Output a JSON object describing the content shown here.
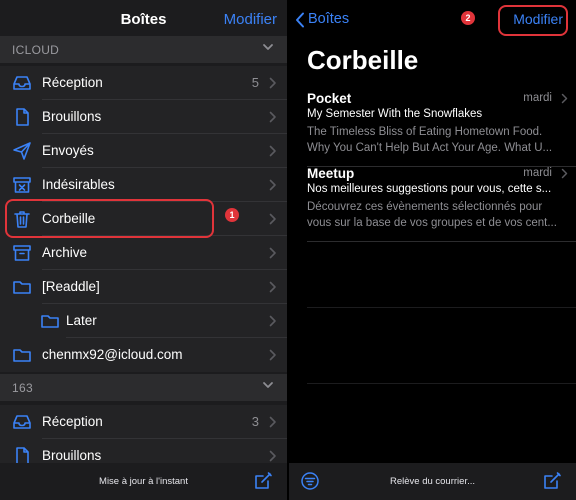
{
  "left": {
    "title": "Boîtes",
    "edit_label": "Modifier",
    "sections": [
      {
        "label": "ICLOUD",
        "items": [
          {
            "icon": "inbox-icon",
            "label": "Réception",
            "count": "5"
          },
          {
            "icon": "document-icon",
            "label": "Brouillons",
            "count": ""
          },
          {
            "icon": "paper-plane-icon",
            "label": "Envoyés",
            "count": ""
          },
          {
            "icon": "junk-icon",
            "label": "Indésirables",
            "count": ""
          },
          {
            "icon": "trash-icon",
            "label": "Corbeille",
            "count": ""
          },
          {
            "icon": "archive-box-icon",
            "label": "Archive",
            "count": ""
          },
          {
            "icon": "folder-icon",
            "label": "[Readdle]",
            "count": ""
          },
          {
            "icon": "folder-icon",
            "label": "Later",
            "count": ""
          },
          {
            "icon": "folder-icon",
            "label": "chenmx92@icloud.com",
            "count": ""
          }
        ]
      },
      {
        "label": "163",
        "items": [
          {
            "icon": "inbox-icon",
            "label": "Réception",
            "count": "3"
          },
          {
            "icon": "document-icon",
            "label": "Brouillons",
            "count": ""
          }
        ]
      }
    ],
    "toolbar_status": "Mise à jour à l'instant",
    "callout_badge": "1"
  },
  "right": {
    "back_label": "Boîtes",
    "edit_label": "Modifier",
    "title": "Corbeille",
    "messages": [
      {
        "from": "Pocket",
        "date": "mardi",
        "subject": "My Semester With the Snowflakes",
        "preview": "The Timeless Bliss of Eating Hometown Food. Why You Can't Help But Act Your Age. What U..."
      },
      {
        "from": "Meetup",
        "date": "mardi",
        "subject": "Nos meilleures suggestions pour vous, cette s...",
        "preview": "Découvrez ces évènements sélectionnés pour vous sur la base de vos groupes et de vos cent..."
      }
    ],
    "toolbar_status": "Relève du courrier...",
    "callout_badge": "2"
  },
  "colors": {
    "accent": "#3b82f6",
    "callout": "#e0343a",
    "pane_bg": "#1c1c1e",
    "row_bg": "#232325",
    "section_bg": "#2c2c2e"
  }
}
